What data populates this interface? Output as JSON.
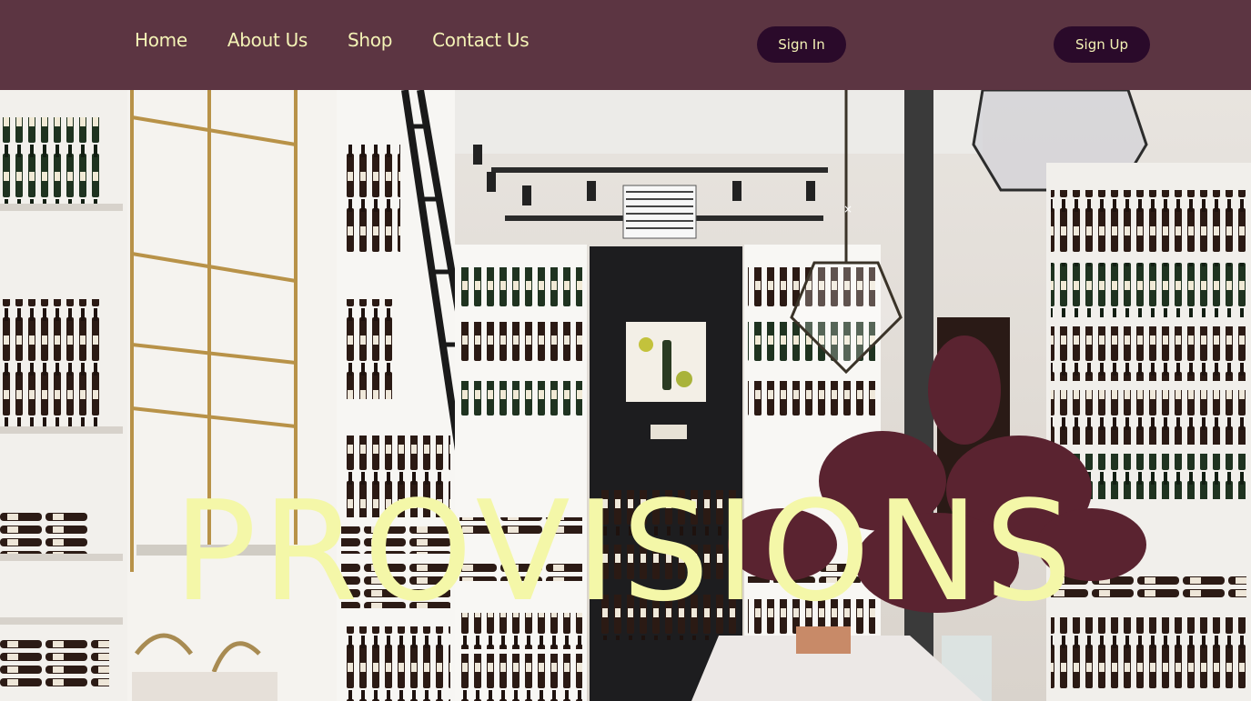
{
  "nav": {
    "items": [
      {
        "label": "Home"
      },
      {
        "label": "About Us"
      },
      {
        "label": "Shop"
      },
      {
        "label": "Contact Us"
      }
    ]
  },
  "auth": {
    "sign_in_label": "Sign In",
    "sign_up_label": "Sign Up"
  },
  "hero": {
    "title": "PROVISIONS",
    "close_glyph": "×"
  },
  "colors": {
    "header_bg": "#5c3542",
    "nav_text": "#f4f3b6",
    "button_bg": "#2a0a2a",
    "hero_title": "#f4f7a8"
  },
  "icons": {
    "close": "close-icon"
  }
}
